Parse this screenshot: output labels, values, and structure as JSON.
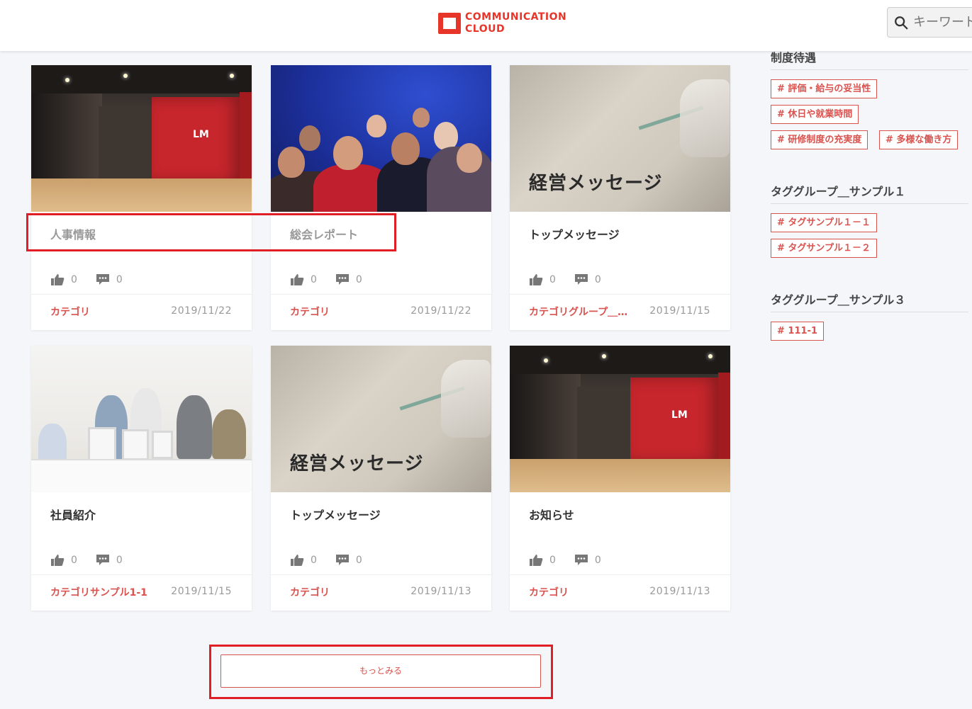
{
  "header": {
    "logo_line1": "COMMUNICATION",
    "logo_line2": "CLOUD",
    "search_placeholder": "キーワード"
  },
  "cards": [
    {
      "title": "人事情報",
      "likes": "0",
      "comments": "0",
      "category": "カテゴリ",
      "date": "2019/11/22",
      "image": "office-hall"
    },
    {
      "title": "総会レポート",
      "likes": "0",
      "comments": "0",
      "category": "カテゴリ",
      "date": "2019/11/22",
      "image": "audience"
    },
    {
      "title": "トップメッセージ",
      "likes": "0",
      "comments": "0",
      "category": "カテゴリグループ＿サ…",
      "date": "2019/11/15",
      "image": "paper",
      "image_caption": "経営メッセージ"
    },
    {
      "title": "社員紹介",
      "likes": "0",
      "comments": "0",
      "category": "カテゴリサンプル1-1",
      "date": "2019/11/15",
      "image": "office-team"
    },
    {
      "title": "トップメッセージ",
      "likes": "0",
      "comments": "0",
      "category": "カテゴリ",
      "date": "2019/11/13",
      "image": "paper",
      "image_caption": "経営メッセージ"
    },
    {
      "title": "お知らせ",
      "likes": "0",
      "comments": "0",
      "category": "カテゴリ",
      "date": "2019/11/13",
      "image": "office-hall"
    }
  ],
  "sidebar": {
    "groups": [
      {
        "title": "制度待遇",
        "tags": [
          "# 評価・給与の妥当性",
          "# 休日や就業時間",
          "# 研修制度の充実度",
          "# 多様な働き方"
        ]
      },
      {
        "title": "タググループ＿サンプル１",
        "tags": [
          "# タグサンプル１－１",
          "# タグサンプル１－２"
        ]
      },
      {
        "title": "タググループ＿サンプル３",
        "tags": [
          "# 111-1"
        ]
      }
    ]
  },
  "more_button": "もっとみる",
  "hall_logo": "LM",
  "colors": {
    "accent": "#d9534f",
    "highlight": "#e01e25",
    "brand": "#e8352a"
  }
}
